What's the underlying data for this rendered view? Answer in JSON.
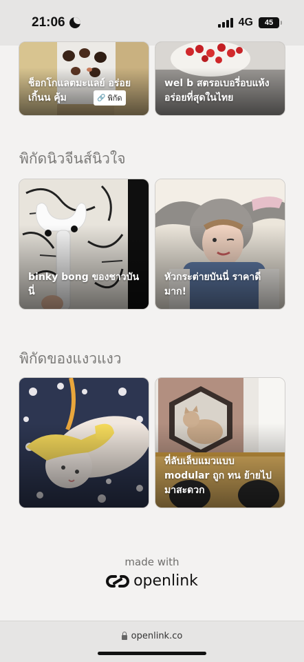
{
  "status_bar": {
    "time": "21:06",
    "network": "4G",
    "battery": "45"
  },
  "sections": [
    {
      "title": "",
      "cards": [
        {
          "title": "ช็อกโกแลตมะแลย์ อร่อยเกิ้นน คุ้ม",
          "badge": "พิกัด"
        },
        {
          "title": "wel b สตรอเบอรี่อบแห้ง อร่อยที่สุดในไทย"
        }
      ]
    },
    {
      "title": "พิกัดนิวจีนส์นิวใจ",
      "cards": [
        {
          "title": "binky bong ของชาวบันนี่"
        },
        {
          "title": "หัวกระต่ายบันนี่ ราคาดีมาก!"
        }
      ]
    },
    {
      "title": "พิกัดของแงวแงว",
      "cards": [
        {
          "title": ""
        },
        {
          "title": "ที่ลับเล็บแมวแบบ modular ถูก ทน ย้ายไปมาสะดวก"
        }
      ]
    }
  ],
  "footer": {
    "made_with": "made with",
    "brand": "openlink"
  },
  "browser": {
    "url": "openlink.co"
  }
}
